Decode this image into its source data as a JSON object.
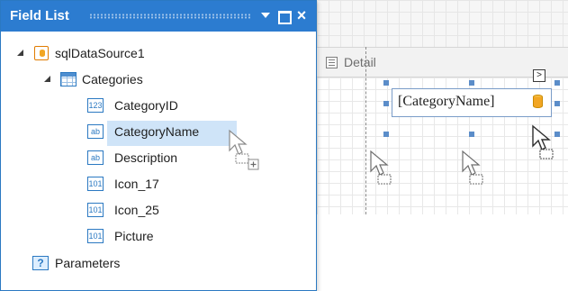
{
  "panel": {
    "title": "Field List",
    "buttons": {
      "dropdown": "chevron-down-icon",
      "maximize": "maximize-icon",
      "close": "×"
    }
  },
  "tree": {
    "datasource": {
      "label": "sqlDataSource1",
      "icon": "database-icon"
    },
    "table": {
      "label": "Categories",
      "icon": "table-icon"
    },
    "fields": [
      {
        "label": "CategoryID",
        "type_badge": "123",
        "icon": "number-field-icon"
      },
      {
        "label": "CategoryName",
        "type_badge": "ab",
        "icon": "string-field-icon",
        "selected": true
      },
      {
        "label": "Description",
        "type_badge": "ab",
        "icon": "string-field-icon"
      },
      {
        "label": "Icon_17",
        "type_badge": "101",
        "icon": "binary-field-icon"
      },
      {
        "label": "Icon_25",
        "type_badge": "101",
        "icon": "binary-field-icon"
      },
      {
        "label": "Picture",
        "type_badge": "101",
        "icon": "binary-field-icon"
      }
    ],
    "parameters": {
      "label": "Parameters",
      "type_badge": "?",
      "icon": "parameters-icon"
    }
  },
  "designer": {
    "band_label": "Detail",
    "smart_tag": ">",
    "label_control_text": "[CategoryName]"
  },
  "colors": {
    "title_bar": "#2c7cd0",
    "selection": "#cfe4f8",
    "handles": "#5b8dc9"
  }
}
